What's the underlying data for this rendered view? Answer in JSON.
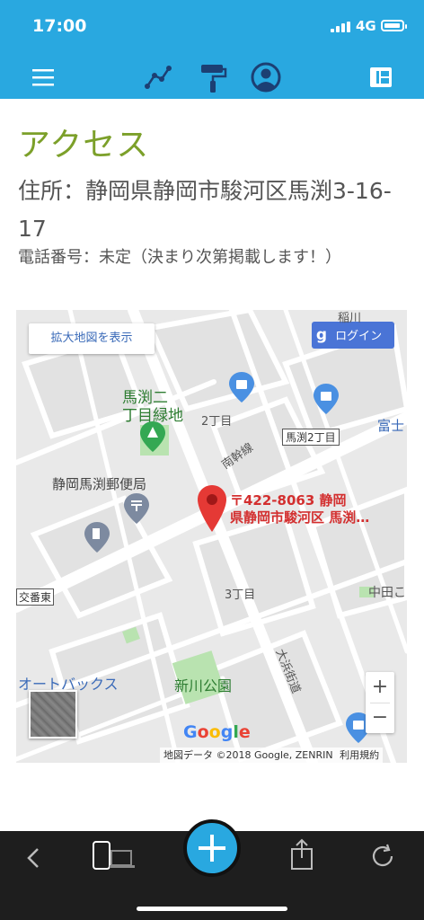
{
  "status": {
    "time": "17:00",
    "network": "4G"
  },
  "nav": {
    "icons": [
      "menu-icon",
      "chart-line-icon",
      "paint-roller-icon",
      "user-circle-icon",
      "layout-icon"
    ]
  },
  "page": {
    "title": "アクセス",
    "address": "住所：静岡県静岡市駿河区馬渕3-16-17",
    "phone": "電話番号：未定（決まり次第掲載します！）"
  },
  "map": {
    "enlarge_label": "拡大地図を表示",
    "login_label": "ログイン",
    "marker_label_1": "〒422-8063 静岡",
    "marker_label_2": "県静岡市駿河区 馬渕…",
    "labels": {
      "park_green": "馬渕二\n丁目緑地",
      "post_office": "静岡馬渕郵便局",
      "chome2": "2丁目",
      "chome2_sign": "馬渕2丁目",
      "minami_line": "南幹線",
      "chome3": "3丁目",
      "koban": "交番東",
      "autobacs": "オートバックス",
      "shinkawa_park": "新川公園",
      "ohama": "大浜街道",
      "fuji": "富士",
      "nakata": "中田こ",
      "inagawa": "稲川"
    },
    "google": "Google",
    "attribution": "地図データ ©2018 Google, ZENRIN",
    "terms": "利用規約",
    "zoom_in": "+",
    "zoom_out": "−"
  },
  "bottom": {
    "icons": [
      "back-icon",
      "device-icon",
      "add-icon",
      "share-icon",
      "reload-icon"
    ]
  },
  "colors": {
    "header": "#29a8e0",
    "title": "#7ca02a",
    "pin": "#e53935",
    "park": "#8ed48a"
  }
}
